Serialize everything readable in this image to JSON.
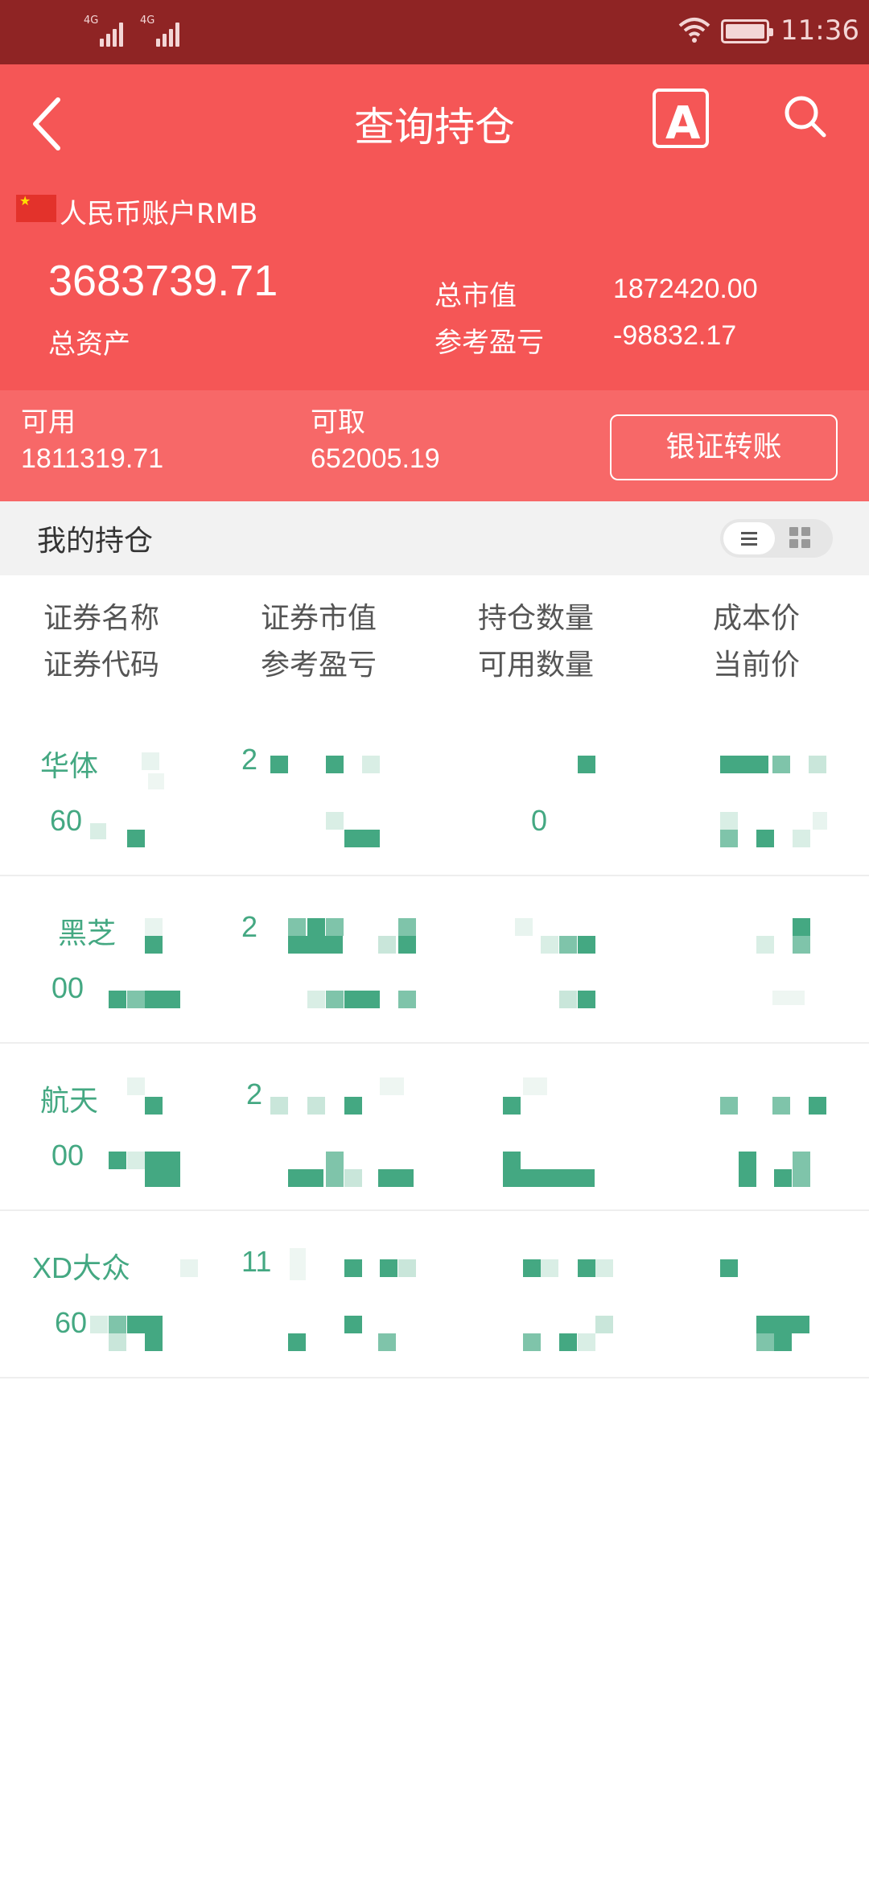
{
  "status_bar": {
    "network_1": "4G",
    "network_2": "4G",
    "time": "11:36"
  },
  "header": {
    "title": "查询持仓",
    "font_button_label": "A",
    "account_label": "人民币账户RMB",
    "total_assets_value": "3683739.71",
    "total_assets_label": "总资产",
    "market_value_label": "总市值",
    "market_value": "1872420.00",
    "profit_loss_label": "参考盈亏",
    "profit_loss_value": "-98832.17"
  },
  "funds": {
    "available_label": "可用",
    "available_value": "1811319.71",
    "withdrawable_label": "可取",
    "withdrawable_value": "652005.19",
    "transfer_button": "银证转账"
  },
  "positions": {
    "title": "我的持仓",
    "columns": [
      {
        "top": "证券名称",
        "bottom": "证券代码"
      },
      {
        "top": "证券市值",
        "bottom": "参考盈亏"
      },
      {
        "top": "持仓数量",
        "bottom": "可用数量"
      },
      {
        "top": "成本价",
        "bottom": "当前价"
      }
    ],
    "rows": [
      {
        "name": "华体",
        "code": "60",
        "market_value": "2",
        "profit": "",
        "quantity": "",
        "available": "0",
        "cost": "",
        "price": ""
      },
      {
        "name": "黑芝",
        "code": "00",
        "market_value": "2",
        "profit": "",
        "quantity": "",
        "available": "",
        "cost": "",
        "price": ""
      },
      {
        "name": "航天",
        "code": "00",
        "market_value": "2",
        "profit": "",
        "quantity": "",
        "available": "",
        "cost": "",
        "price": ""
      },
      {
        "name": "XD大众",
        "code": "60",
        "market_value": "11",
        "profit": "",
        "quantity": "",
        "available": "",
        "cost": "",
        "price": ""
      }
    ]
  },
  "colors": {
    "status_bar": "#8f2424",
    "header_red": "#f55656",
    "funds_band": "#f76868",
    "stock_green": "#44a882"
  }
}
